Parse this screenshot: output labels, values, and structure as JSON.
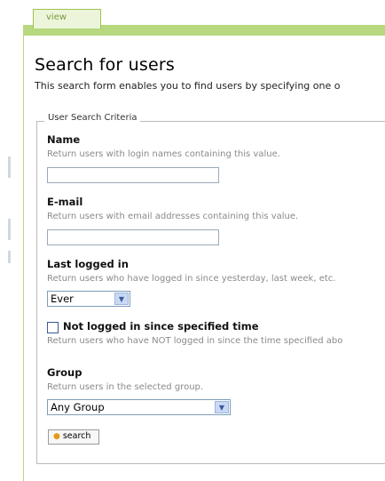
{
  "tabs": [
    {
      "label": "view"
    }
  ],
  "page": {
    "title": "Search for users",
    "description": "This search form enables you to find users by specifying one o"
  },
  "criteria": {
    "legend": "User Search Criteria",
    "name": {
      "label": "Name",
      "help": "Return users with login names containing this value.",
      "value": ""
    },
    "email": {
      "label": "E-mail",
      "help": "Return users with email addresses containing this value.",
      "value": ""
    },
    "last_logged_in": {
      "label": "Last logged in",
      "help": "Return users who have logged in since yesterday, last week, etc.",
      "selected": "Ever"
    },
    "not_logged_in": {
      "label": "Not logged in since specified time",
      "help": "Return users who have NOT logged in since the time specified abo",
      "checked": false
    },
    "group": {
      "label": "Group",
      "help": "Return users in the selected group.",
      "selected": "Any Group"
    },
    "search_label": "search"
  },
  "icons": {
    "dropdown": "chevron-down-icon",
    "search_bullet": "bullet-icon"
  },
  "colors": {
    "tab_bar": "#b7d87f",
    "select_arrow": "#c9d9f5"
  }
}
